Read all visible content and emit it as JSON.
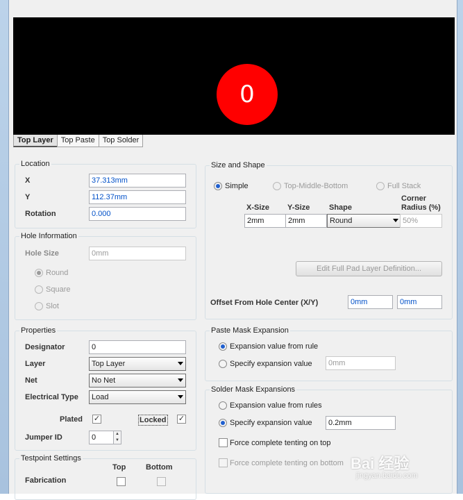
{
  "preview": {
    "pad_label": "0",
    "tabs": [
      "Top Layer",
      "Top Paste",
      "Top Solder"
    ]
  },
  "location": {
    "title": "Location",
    "x_label": "X",
    "x_value": "37.313mm",
    "y_label": "Y",
    "y_value": "112.37mm",
    "rotation_label": "Rotation",
    "rotation_value": "0.000"
  },
  "hole": {
    "title": "Hole Information",
    "size_label": "Hole Size",
    "size_value": "0mm",
    "shapes": [
      "Round",
      "Square",
      "Slot"
    ]
  },
  "properties": {
    "title": "Properties",
    "designator_label": "Designator",
    "designator_value": "0",
    "layer_label": "Layer",
    "layer_value": "Top Layer",
    "net_label": "Net",
    "net_value": "No Net",
    "etype_label": "Electrical Type",
    "etype_value": "Load",
    "plated_label": "Plated",
    "locked_label": "Locked",
    "jumper_label": "Jumper ID",
    "jumper_value": "0"
  },
  "testpoint": {
    "title": "Testpoint Settings",
    "top_label": "Top",
    "bottom_label": "Bottom",
    "fab_label": "Fabrication"
  },
  "size_shape": {
    "title": "Size and Shape",
    "modes": [
      "Simple",
      "Top-Middle-Bottom",
      "Full Stack"
    ],
    "col_x": "X-Size",
    "col_y": "Y-Size",
    "col_shape": "Shape",
    "col_corner_1": "Corner",
    "col_corner_2": "Radius (%)",
    "x_value": "2mm",
    "y_value": "2mm",
    "shape_value": "Round",
    "corner_value": "50%",
    "edit_button": "Edit Full Pad Layer Definition...",
    "offset_label": "Offset From Hole Center (X/Y)",
    "offset_x": "0mm",
    "offset_y": "0mm"
  },
  "paste": {
    "title": "Paste Mask Expansion",
    "opt_rule": "Expansion value from rule",
    "opt_specify": "Specify expansion value",
    "value": "0mm"
  },
  "solder": {
    "title": "Solder Mask Expansions",
    "opt_rule": "Expansion value from rules",
    "opt_specify": "Specify expansion value",
    "value": "0.2mm",
    "tent_top": "Force complete tenting on top",
    "tent_bottom": "Force complete tenting on bottom"
  },
  "watermark": {
    "main": "Bai 经验",
    "sub": "jingyan.baidu.com"
  }
}
